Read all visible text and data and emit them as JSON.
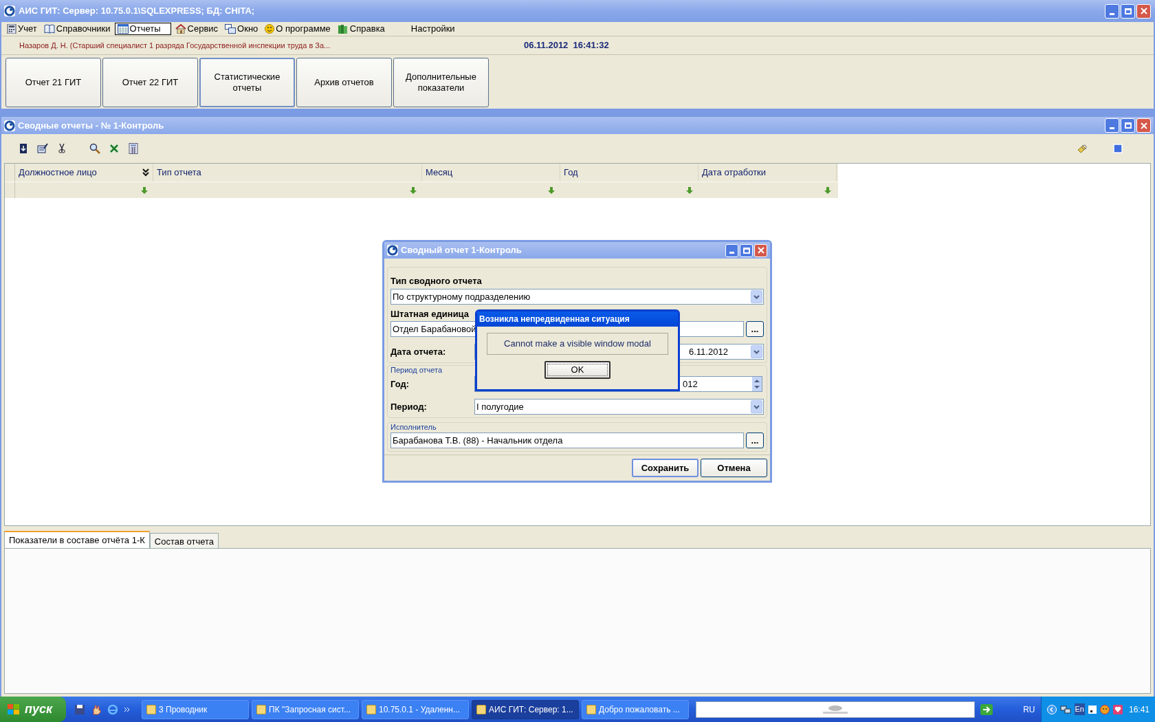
{
  "window": {
    "title": "АИС ГИТ:  Сервер: 10.75.0.1\\SQLEXPRESS;  БД: CHITA;"
  },
  "menu": [
    {
      "label": "Учет",
      "selected": false
    },
    {
      "label": "Справочники",
      "selected": false
    },
    {
      "label": "Отчеты",
      "selected": true
    },
    {
      "label": "Сервис",
      "selected": false
    },
    {
      "label": "Окно",
      "selected": false
    },
    {
      "label": "О программе",
      "selected": false
    },
    {
      "label": "Справка",
      "selected": false
    },
    {
      "label": "Настройки",
      "selected": false
    }
  ],
  "user_info": "Назаров Д. Н. (Старший специалист 1 разряда Государственной инспекции труда в За...",
  "datetime": "06.11.2012  16:41:32",
  "nav_buttons": [
    {
      "label": "Отчет 21 ГИТ",
      "selected": false
    },
    {
      "label": "Отчет 22 ГИТ",
      "selected": false
    },
    {
      "label": "Статистические отчеты",
      "selected": true
    },
    {
      "label": "Архив отчетов",
      "selected": false
    },
    {
      "label": "Дополнительные показатели",
      "selected": false
    }
  ],
  "child_window": {
    "title": "Сводные отчеты - № 1-Контроль"
  },
  "grid": {
    "columns": [
      "Должностное лицо",
      "Тип отчета",
      "Месяц",
      "Год",
      "Дата отработки"
    ]
  },
  "dialog": {
    "title": "Сводный отчет 1-Контроль",
    "report_type_label": "Тип сводного отчета",
    "report_type": "По структурному подразделению",
    "unit_label": "Штатная единица",
    "unit": "Отдел Барабановой",
    "unit_button": "...",
    "date_label": "Дата отчета:",
    "date": "6.11.2012",
    "period_group": "Период отчета",
    "year_label": "Год:",
    "year": "012",
    "period_label": "Период:",
    "period": "I полугодие",
    "executor_group": "Исполнитель",
    "executor": "Барабанова Т.В. (88) - Начальник отдела",
    "executor_button": "...",
    "buttons": [
      {
        "label": "Сохранить",
        "selected": true
      },
      {
        "label": "Отмена",
        "selected": false
      }
    ]
  },
  "error_dialog": {
    "title": "Возникла непредвиденная ситуация",
    "message": "Cannot make a visible window modal",
    "button": "OK"
  },
  "bottom_tabs": [
    {
      "label": "Показатели в составе отчёта 1-К",
      "selected": true
    },
    {
      "label": "Состав отчета",
      "selected": false
    }
  ],
  "taskbar": {
    "start": "пуск",
    "items": [
      {
        "label": "3 Проводник",
        "selected": false
      },
      {
        "label": "ПК \"Запросная сист...",
        "selected": false
      },
      {
        "label": "10.75.0.1 - Удаленн...",
        "selected": false
      },
      {
        "label": "АИС ГИТ:  Сервер: 1...",
        "selected": true
      },
      {
        "label": "Добро пожаловать ...",
        "selected": false
      }
    ],
    "language": "RU",
    "keyboard": "En",
    "clock": "16:41"
  }
}
